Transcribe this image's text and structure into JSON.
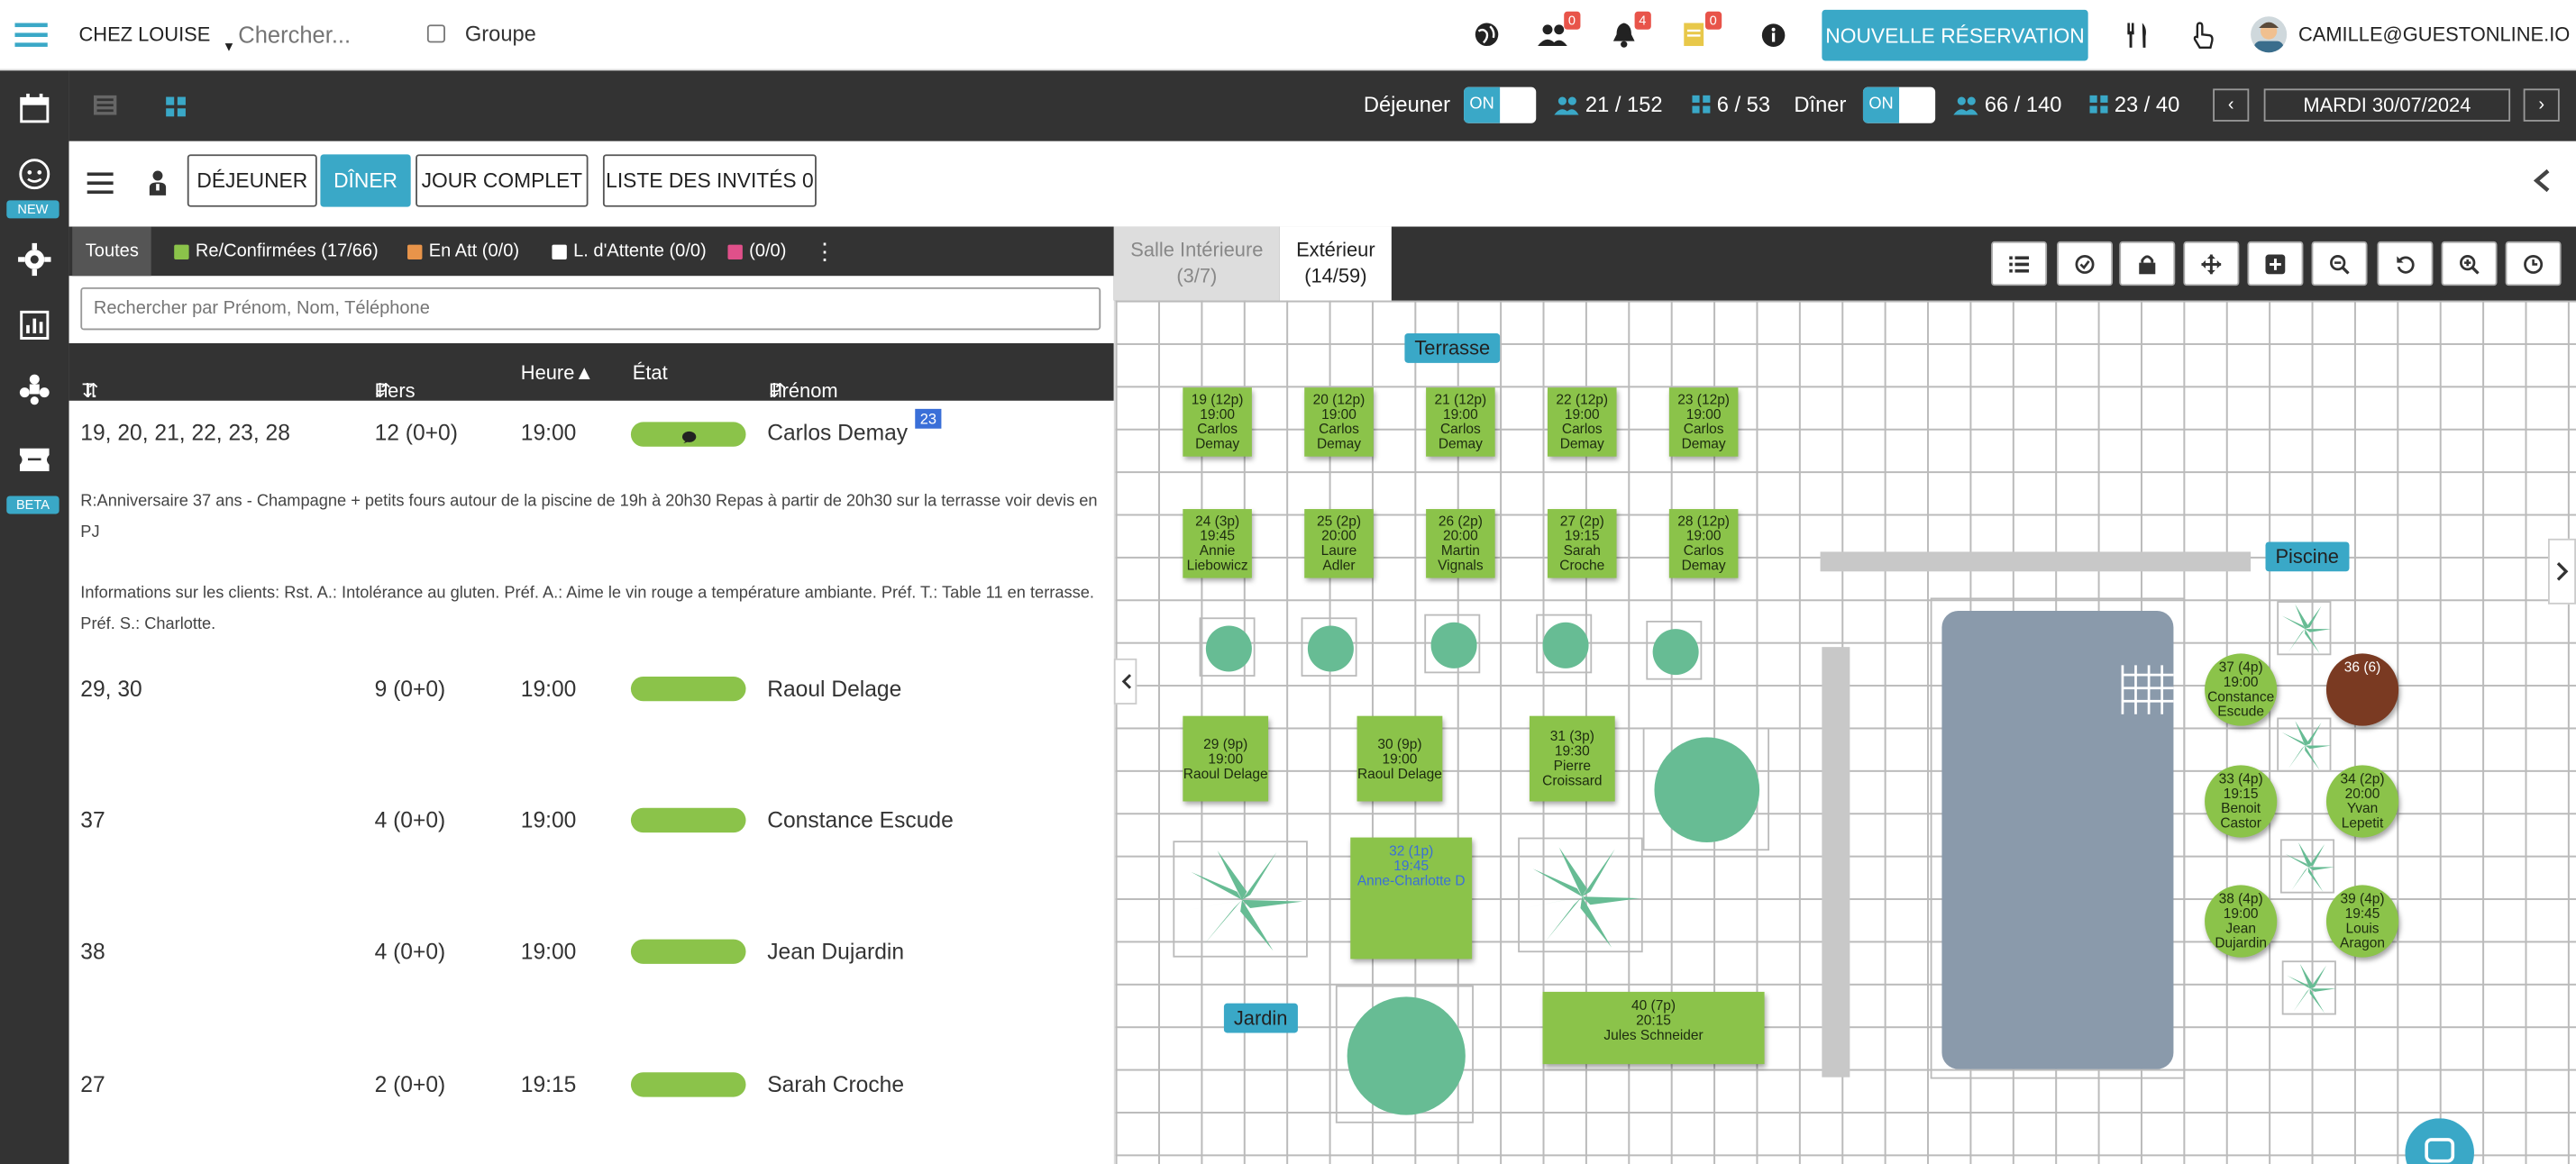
{
  "topbar": {
    "restaurant": "CHEZ LOUISE",
    "search_placeholder": "Chercher...",
    "group_label": "Groupe",
    "badges": {
      "people": "0",
      "bell": "4",
      "notes": "0"
    },
    "new_booking": "NOUVELLE RÉSERVATION",
    "user": "CAMILLE@GUESTONLINE.IO"
  },
  "sidebar": {
    "tags": {
      "new": "NEW",
      "beta": "BETA"
    }
  },
  "services": {
    "lunch_label": "Déjeuner",
    "lunch_toggle": "ON",
    "lunch_guests": "21 / 152",
    "lunch_tables": "6 / 53",
    "dinner_label": "Dîner",
    "dinner_toggle": "ON",
    "dinner_guests": "66 / 140",
    "dinner_tables": "23 / 40",
    "date": "MARDI 30/07/2024"
  },
  "view_buttons": {
    "lunch": "DÉJEUNER",
    "dinner": "DÎNER",
    "full_day": "JOUR COMPLET",
    "guest_list": "LISTE DES INVITÉS 0"
  },
  "filters": {
    "all": "Toutes",
    "confirmed": "Re/Confirmées (17/66)",
    "pending": "En Att (0/0)",
    "waitlist": "L. d'Attente (0/0)",
    "other": "(0/0)"
  },
  "list_search_placeholder": "Rechercher par Prénom, Nom, Téléphone",
  "columns": {
    "table": "T.",
    "pers": "Pers",
    "time": "Heure▲",
    "state": "État",
    "name": "Prénom"
  },
  "rows": [
    {
      "tables": "19, 20, 21, 22, 23, 28",
      "pers": "12 (0+0)",
      "time": "19:00",
      "name": "Carlos Demay",
      "badge": "23"
    },
    {
      "tables": "29, 30",
      "pers": "9 (0+0)",
      "time": "19:00",
      "name": "Raoul Delage"
    },
    {
      "tables": "37",
      "pers": "4 (0+0)",
      "time": "19:00",
      "name": "Constance Escude"
    },
    {
      "tables": "38",
      "pers": "4 (0+0)",
      "time": "19:00",
      "name": "Jean Dujardin"
    },
    {
      "tables": "27",
      "pers": "2 (0+0)",
      "time": "19:15",
      "name": "Sarah Croche"
    }
  ],
  "notes": {
    "remark": "R:Anniversaire 37 ans - Champagne + petits fours autour de la piscine de 19h à 20h30 Repas à partir de 20h30 sur la terrasse voir devis en PJ",
    "info": "Informations sur les clients: Rst. A.: Intolérance au gluten. Préf. A.: Aime le vin rouge a température ambiante. Préf. T.: Table 11 en terrasse. Préf. S.: Charlotte."
  },
  "rooms": {
    "indoor": "Salle Intérieure",
    "indoor_count": "(3/7)",
    "outdoor": "Extérieur",
    "outdoor_count": "(14/59)"
  },
  "areas": {
    "terrace": "Terrasse",
    "pool": "Piscine",
    "garden": "Jardin"
  },
  "tables": [
    {
      "num": "19 (12p)",
      "time": "19:00",
      "name": "Carlos Demay"
    },
    {
      "num": "20 (12p)",
      "time": "19:00",
      "name": "Carlos Demay"
    },
    {
      "num": "21 (12p)",
      "time": "19:00",
      "name": "Carlos Demay"
    },
    {
      "num": "22 (12p)",
      "time": "19:00",
      "name": "Carlos Demay"
    },
    {
      "num": "23 (12p)",
      "time": "19:00",
      "name": "Carlos Demay"
    },
    {
      "num": "24 (3p)",
      "time": "19:45",
      "name": "Annie Liebowicz"
    },
    {
      "num": "25 (2p)",
      "time": "20:00",
      "name": "Laure Adler"
    },
    {
      "num": "26 (2p)",
      "time": "20:00",
      "name": "Martin Vignals"
    },
    {
      "num": "27 (2p)",
      "time": "19:15",
      "name": "Sarah Croche"
    },
    {
      "num": "28 (12p)",
      "time": "19:00",
      "name": "Carlos Demay"
    },
    {
      "num": "29 (9p)",
      "time": "19:00",
      "name": "Raoul Delage"
    },
    {
      "num": "30 (9p)",
      "time": "19:00",
      "name": "Raoul Delage"
    },
    {
      "num": "31 (3p)",
      "time": "19:30",
      "name": "Pierre Croissard"
    },
    {
      "num": "32 (1p)",
      "time": "19:45",
      "name": "Anne-Charlotte D"
    },
    {
      "num": "40 (7p)",
      "time": "20:15",
      "name": "Jules Schneider"
    },
    {
      "num": "37 (4p)",
      "time": "19:00",
      "name": "Constance Escude"
    },
    {
      "num": "36 (6)",
      "time": "",
      "name": ""
    },
    {
      "num": "33 (4p)",
      "time": "19:15",
      "name": "Benoit Castor"
    },
    {
      "num": "34 (2p)",
      "time": "20:00",
      "name": "Yvan Lepetit"
    },
    {
      "num": "38 (4p)",
      "time": "19:00",
      "name": "Jean Dujardin"
    },
    {
      "num": "39 (4p)",
      "time": "19:45",
      "name": "Louis Aragon"
    }
  ],
  "colors": {
    "accent": "#3aa8c7",
    "table_green": "#8bc34a",
    "dark": "#333333",
    "badge_red": "#e8544a"
  }
}
